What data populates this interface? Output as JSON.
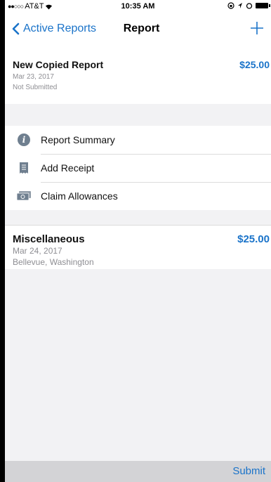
{
  "status_bar": {
    "carrier": "AT&T",
    "time": "10:35 AM"
  },
  "navbar": {
    "back_label": "Active Reports",
    "title": "Report",
    "add_icon": "plus-icon"
  },
  "report": {
    "name": "New Copied Report",
    "amount": "$25.00",
    "date": "Mar 23, 2017",
    "status": "Not Submitted"
  },
  "menu": {
    "items": [
      {
        "label": "Report Summary",
        "icon": "info-icon"
      },
      {
        "label": "Add Receipt",
        "icon": "receipt-icon"
      },
      {
        "label": "Claim Allowances",
        "icon": "money-icon"
      }
    ]
  },
  "expense": {
    "name": "Miscellaneous",
    "amount": "$25.00",
    "date": "Mar 24, 2017",
    "location": "Bellevue, Washington"
  },
  "toolbar": {
    "submit_label": "Submit"
  },
  "colors": {
    "accent": "#1a73c9",
    "background": "#f2f2f4",
    "toolbar": "#d3d3d6"
  }
}
